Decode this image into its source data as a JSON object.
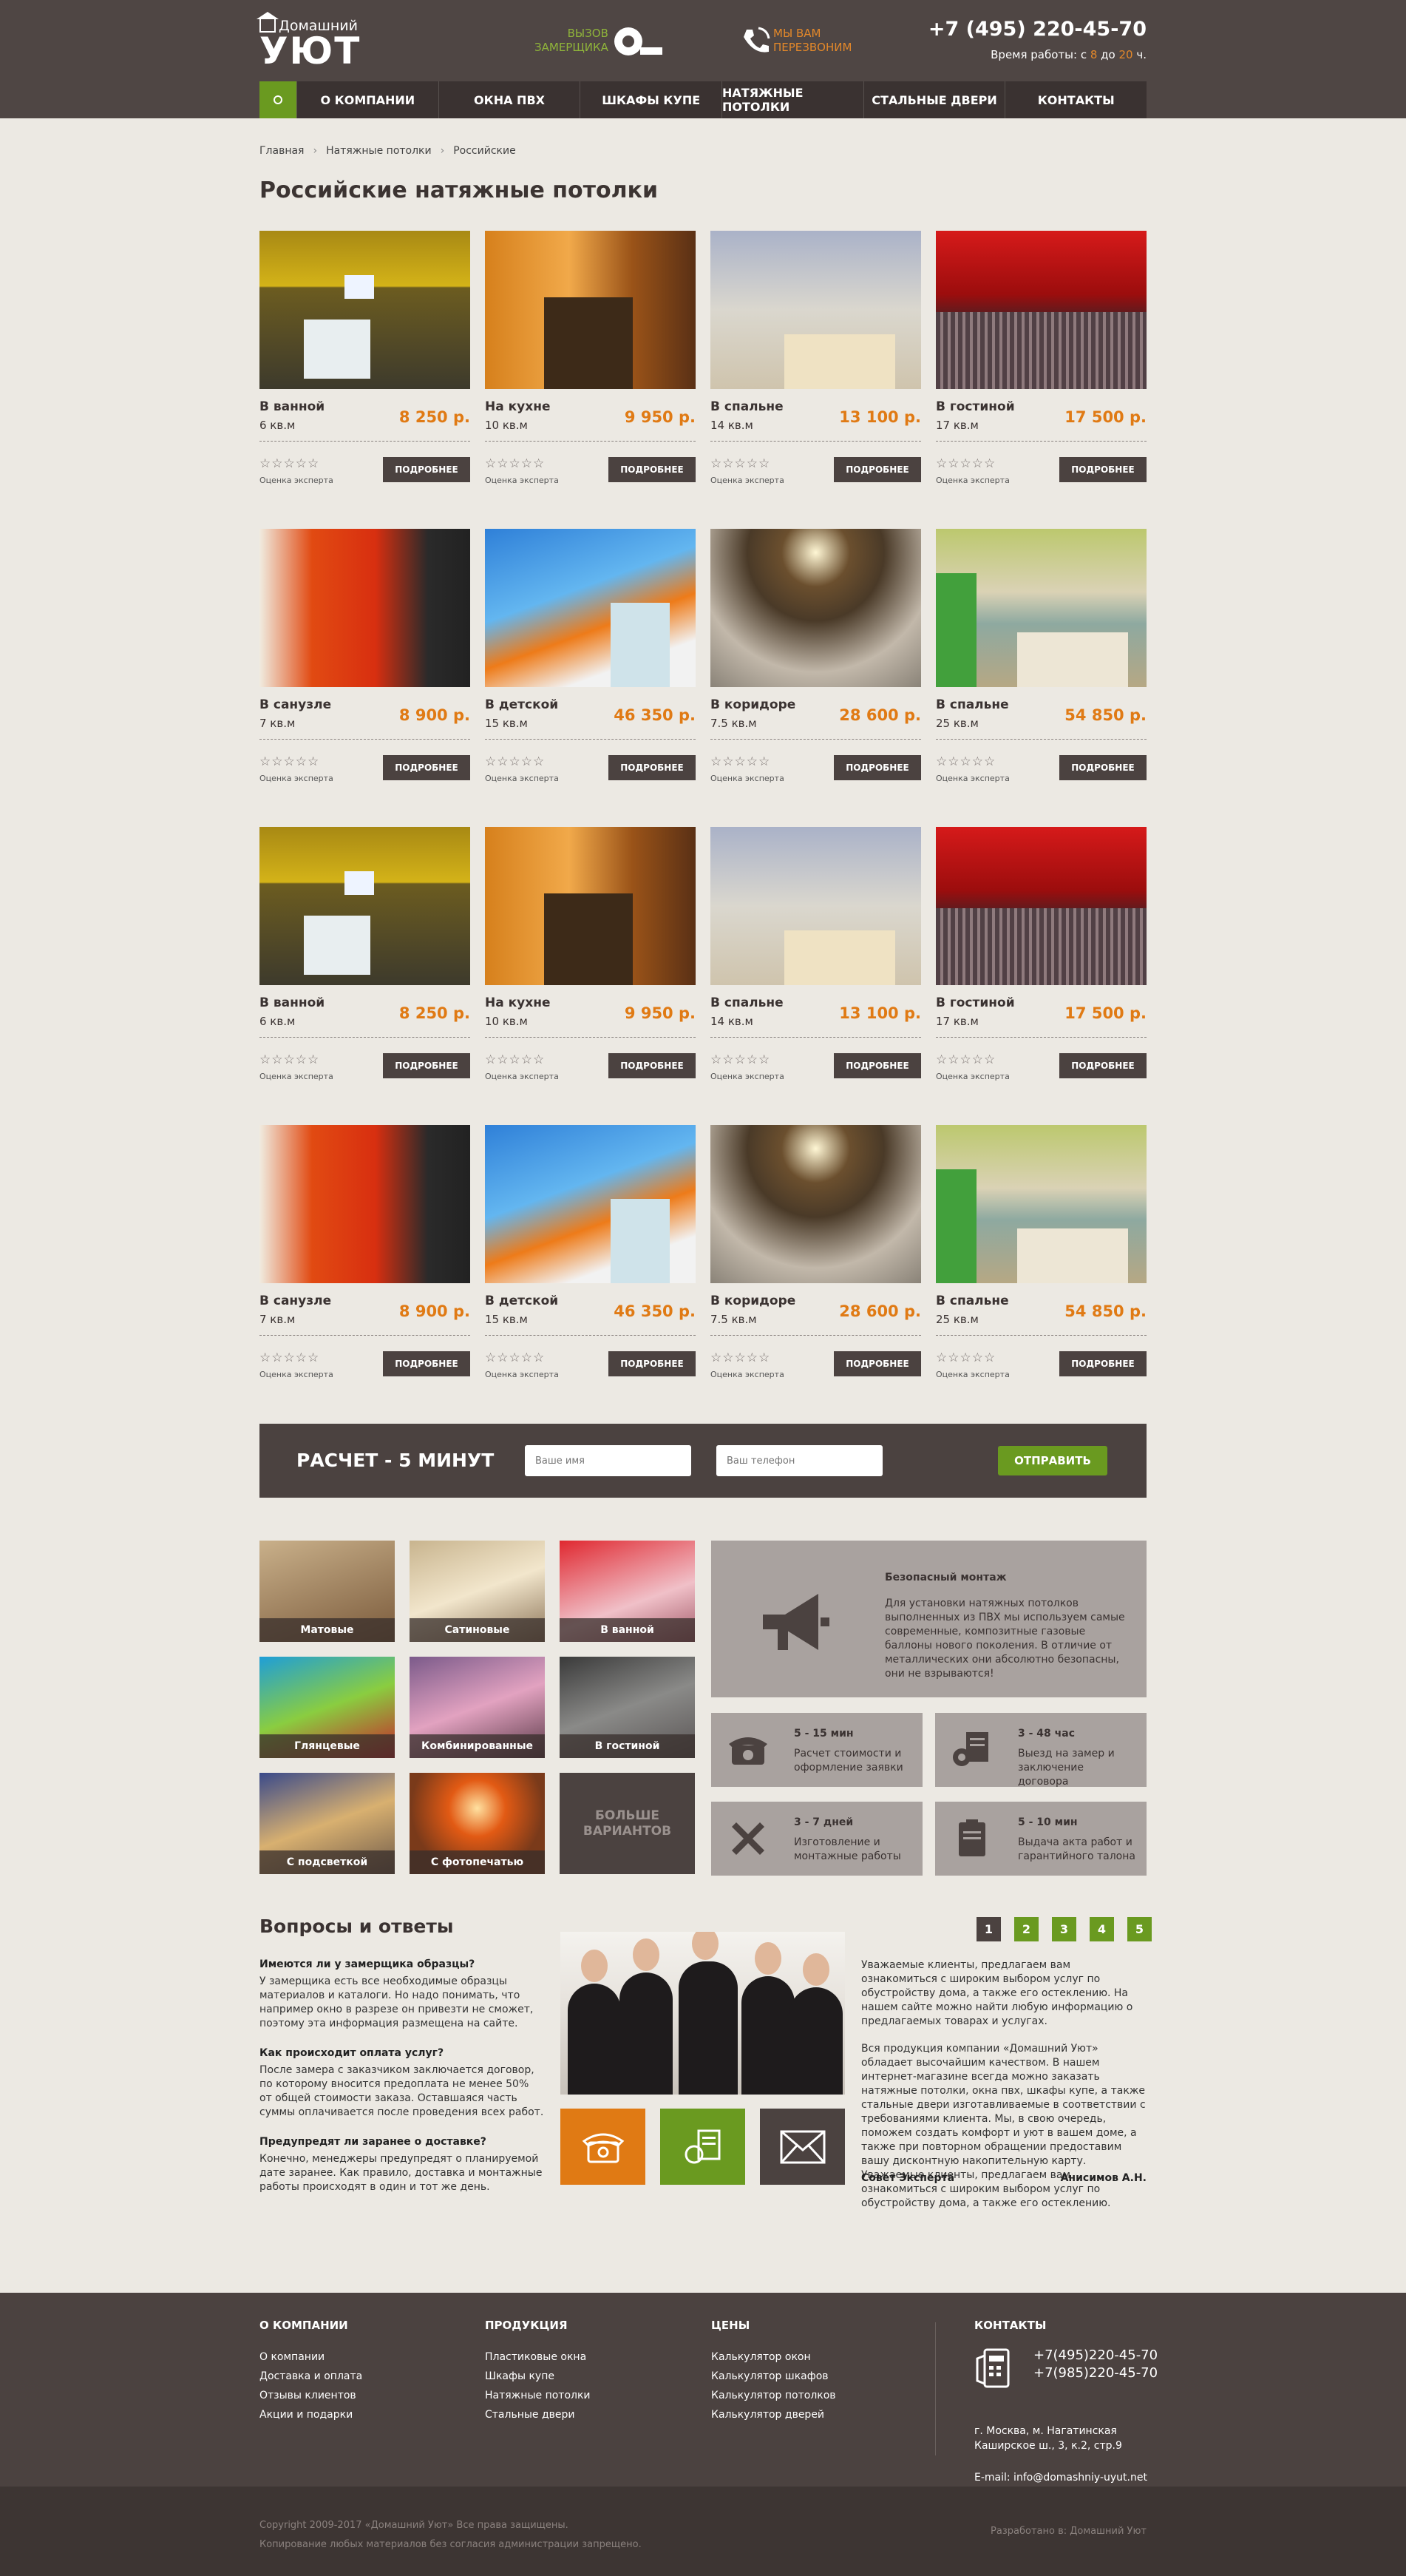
{
  "header": {
    "logo_small": "Домашний",
    "logo_big": "УЮТ",
    "callout1_line1": "вызов",
    "callout1_line2": "замерщика",
    "callout2_line1": "мы вам",
    "callout2_line2": "перезвоним",
    "phone": "+7 (495) 220-45-70",
    "hours_prefix": "Время работы: с ",
    "hours_from": "8",
    "hours_mid": " до ",
    "hours_to": "20",
    "hours_suffix": " ч."
  },
  "nav": {
    "items": [
      "О компании",
      "Окна ПВХ",
      "Шкафы купе",
      "Натяжные потолки",
      "Стальные двери",
      "Контакты"
    ]
  },
  "breadcrumb": [
    "Главная",
    "Натяжные потолки",
    "Российские"
  ],
  "page_title": "Российские натяжные потолки",
  "products": [
    {
      "name": "В ванной",
      "area": "6 кв.м",
      "price": "8 250 р."
    },
    {
      "name": "На кухне",
      "area": "10 кв.м",
      "price": "9 950 р."
    },
    {
      "name": "В спальне",
      "area": "14 кв.м",
      "price": "13 100 р."
    },
    {
      "name": "В гостиной",
      "area": "17 кв.м",
      "price": "17 500 р."
    },
    {
      "name": "В санузле",
      "area": "7 кв.м",
      "price": "8 900 р."
    },
    {
      "name": "В детской",
      "area": "15 кв.м",
      "price": "46 350 р."
    },
    {
      "name": "В коридоре",
      "area": "7.5 кв.м",
      "price": "28 600 р."
    },
    {
      "name": "В спальне",
      "area": "25 кв.м",
      "price": "54 850 р."
    },
    {
      "name": "В ванной",
      "area": "6 кв.м",
      "price": "8 250 р."
    },
    {
      "name": "На кухне",
      "area": "10 кв.м",
      "price": "9 950 р."
    },
    {
      "name": "В спальне",
      "area": "14 кв.м",
      "price": "13 100 р."
    },
    {
      "name": "В гостиной",
      "area": "17 кв.м",
      "price": "17 500 р."
    },
    {
      "name": "В санузле",
      "area": "7 кв.м",
      "price": "8 900 р."
    },
    {
      "name": "В детской",
      "area": "15 кв.м",
      "price": "46 350 р."
    },
    {
      "name": "В коридоре",
      "area": "7.5 кв.м",
      "price": "28 600 р."
    },
    {
      "name": "В спальне",
      "area": "25 кв.м",
      "price": "54 850 р."
    }
  ],
  "product_common": {
    "stars": "☆☆☆☆☆",
    "rating_label": "Оценка эксперта",
    "more_label": "Подробнее"
  },
  "raschet": {
    "title_prefix": "Расчет - ",
    "title_num": "5 минут",
    "name_placeholder": "Ваше имя",
    "phone_placeholder": "Ваш телефон",
    "send": "Отправить"
  },
  "categories": [
    "Матовые",
    "Сатиновые",
    "В ванной",
    "Глянцевые",
    "Комбинированные",
    "В гостиной",
    "С подсветкой",
    "С фотопечатью"
  ],
  "more_variants": "Больше вариантов",
  "feature_big": {
    "title": "Безопасный монтаж",
    "text": "Для установки натяжных потолков выполненных из ПВХ мы используем самые современные, композитные газовые баллоны нового поколения. В отличие от металлических они абсолютно безопасны, они не взрываются!"
  },
  "features": [
    {
      "title": "5 - 15 мин",
      "text": "Расчет стоимости и оформление заявки"
    },
    {
      "title": "3 - 48 час",
      "text": "Выезд на замер и заключение договора"
    },
    {
      "title": "3 - 7 дней",
      "text": "Изготовление и монтажные работы"
    },
    {
      "title": "5 - 10 мин",
      "text": "Выдача акта работ и гарантийного талона"
    }
  ],
  "faq": {
    "title": "Вопросы и ответы",
    "items": [
      {
        "q": "Имеются ли у замерщика образцы?",
        "a": "У замерщика есть все необходимые образцы материалов и каталоги. Но надо понимать, что например окно в разрезе он привезти не сможет, поэтому эта информация размещена на сайте."
      },
      {
        "q": "Как происходит оплата услуг?",
        "a": "После замера с заказчиком заключается договор, по которому вносится предоплата не менее 50% от общей стоимости заказа. Оставшаяся часть суммы оплачивается после проведения всех работ."
      },
      {
        "q": "Предупредят ли заранее о доставке?",
        "a": "Конечно, менеджеры предупредят о планируемой дате заранее. Как правило, доставка и монтажные работы происходят в один и тот же день."
      }
    ],
    "pager": [
      "1",
      "2",
      "3",
      "4",
      "5"
    ],
    "expert_p1": "Уважаемые клиенты, предлагаем вам ознакомиться с широким выбором услуг по обустройству дома, а также его остеклению. На нашем сайте можно найти любую информацию о предлагаемых товарах и услугах.",
    "expert_p2": "Вся продукция компании «Домашний Уют» обладает высочайшим качеством. В нашем интернет-магазине всегда можно заказать натяжные потолки, окна пвх, шкафы купе, а также стальные двери изготавливаемые в соответствии с требованиями клиента. Мы, в свою очередь, поможем создать комфорт и уют в вашем доме, а также при повторном обращении предоставим вашу дисконтную накопительную карту. Уважаемые клиенты, предлагаем вам ознакомиться с широким выбором услуг по обустройству дома, а также его остеклению.",
    "expert_label": "Совет Эксперта",
    "expert_name": "Анисимов А.Н."
  },
  "footer": {
    "col1_title": "О компании",
    "col1": [
      "О компании",
      "Доставка и оплата",
      "Отзывы клиентов",
      "Акции и подарки"
    ],
    "col2_title": "Продукция",
    "col2": [
      "Пластиковые окна",
      "Шкафы купе",
      "Натяжные потолки",
      "Стальные двери"
    ],
    "col3_title": "Цены",
    "col3": [
      "Калькулятор окон",
      "Калькулятор шкафов",
      "Калькулятор потолков",
      "Калькулятор дверей"
    ],
    "contacts_title": "Контакты",
    "phone1": "+7(495)220-45-70",
    "phone2": "+7(985)220-45-70",
    "addr1": "г. Москва, м. Нагатинская",
    "addr2": "Каширское ш., 3, к.2, стр.9",
    "email": "E-mail: info@domashniy-uyut.net",
    "copy1": "Copyright 2009-2017 «Домашний Уют» Все права защищены.",
    "copy2": "Копирование любых материалов без согласия администрации запрещено.",
    "dev": "Разработано в: Домашний Уют"
  },
  "colors": {
    "brand_dark": "#4b4240",
    "accent_green": "#6a9a20",
    "accent_orange": "#e07a14",
    "background": "#ece9e3"
  }
}
